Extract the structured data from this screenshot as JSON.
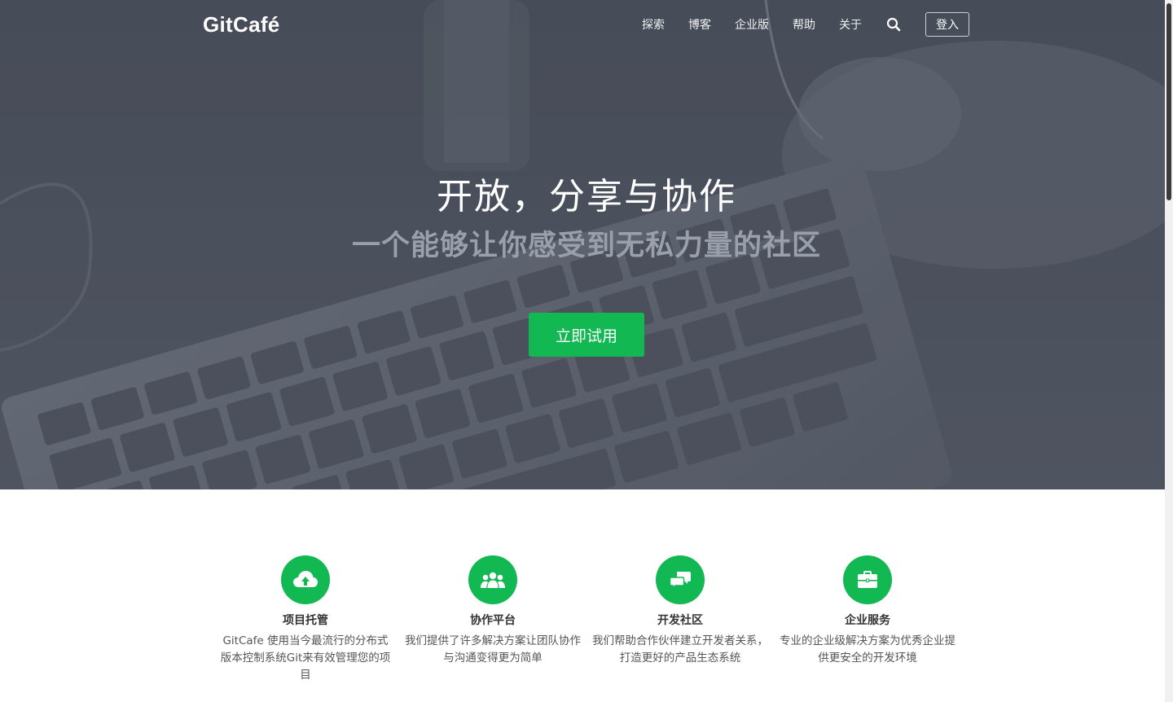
{
  "nav": {
    "logo": "GitCafé",
    "items": [
      {
        "label": "探索"
      },
      {
        "label": "博客"
      },
      {
        "label": "企业版"
      },
      {
        "label": "帮助"
      },
      {
        "label": "关于"
      }
    ],
    "search_icon": "search-icon",
    "login_label": "登入"
  },
  "hero": {
    "title": "开放，分享与协作",
    "subtitle": "一个能够让你感受到无私力量的社区",
    "cta_label": "立即试用"
  },
  "features": [
    {
      "icon": "cloud-upload-icon",
      "title": "项目托管",
      "desc": "GitCafe 使用当今最流行的分布式版本控制系统Git来有效管理您的项目"
    },
    {
      "icon": "users-group-icon",
      "title": "协作平台",
      "desc": "我们提供了许多解决方案让团队协作与沟通变得更为简单"
    },
    {
      "icon": "chat-bubbles-icon",
      "title": "开发社区",
      "desc": "我们帮助合作伙伴建立开发者关系，打造更好的产品生态系统"
    },
    {
      "icon": "briefcase-icon",
      "title": "企业服务",
      "desc": "专业的企业级解决方案为优秀企业提供更安全的开发环境"
    }
  ],
  "colors": {
    "accent_green": "#12b852",
    "hero_bg": "#4e535f",
    "subtitle_gray": "#9aa0ab"
  }
}
